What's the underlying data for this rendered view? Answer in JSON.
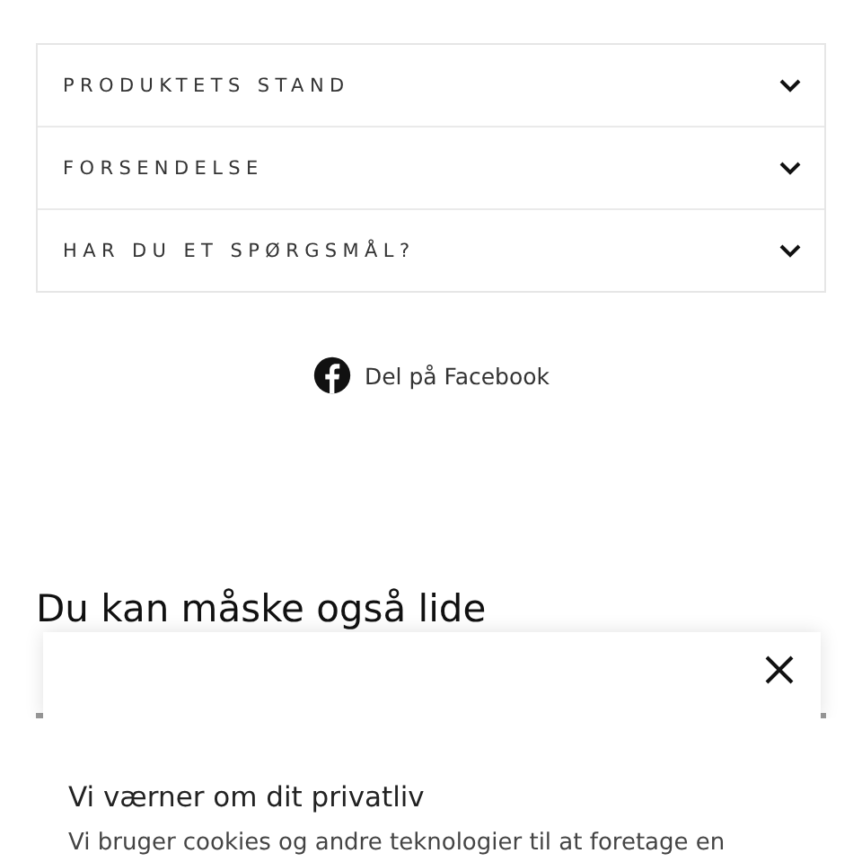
{
  "accordion": [
    {
      "label": "PRODUKTETS STAND",
      "expanded": false
    },
    {
      "label": "FORSENDELSE",
      "expanded": false
    },
    {
      "label": "HAR DU ET SPØRGSMÅL?",
      "expanded": false
    }
  ],
  "share": {
    "label": "Del på Facebook"
  },
  "related": {
    "heading": "Du kan måske også lide"
  },
  "cookie_banner": {
    "title": "Vi værner om dit privatliv",
    "text": "Vi bruger cookies og andre teknologier til at foretage en"
  }
}
